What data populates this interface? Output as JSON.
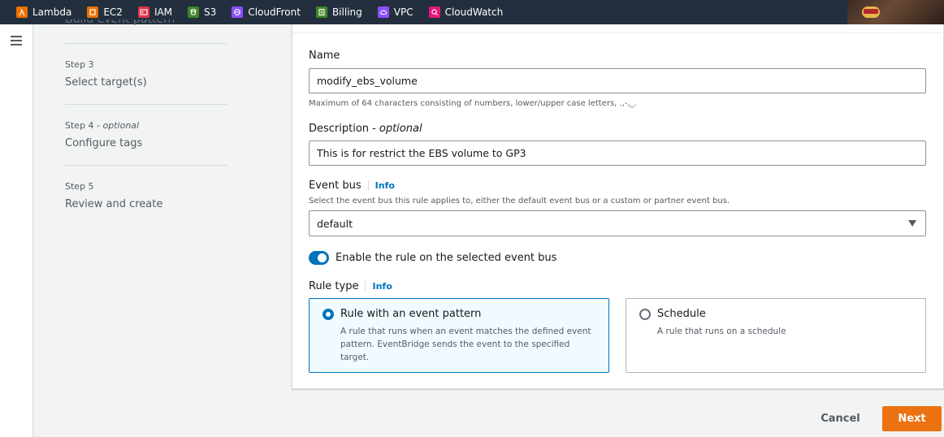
{
  "favorites": [
    {
      "label": "Lambda",
      "icon": "lambda-icon",
      "color": "#ed7100"
    },
    {
      "label": "EC2",
      "icon": "ec2-icon",
      "color": "#ed7100"
    },
    {
      "label": "IAM",
      "icon": "iam-icon",
      "color": "#dd344c"
    },
    {
      "label": "S3",
      "icon": "s3-icon",
      "color": "#3f8624"
    },
    {
      "label": "CloudFront",
      "icon": "cloudfront-icon",
      "color": "#8c4fff"
    },
    {
      "label": "Billing",
      "icon": "billing-icon",
      "color": "#3f8624"
    },
    {
      "label": "VPC",
      "icon": "vpc-icon",
      "color": "#8c4fff"
    },
    {
      "label": "CloudWatch",
      "icon": "cloudwatch-icon",
      "color": "#e7157b"
    }
  ],
  "steps": {
    "cut_off_title": "Build event pattern",
    "items": [
      {
        "number": "Step 3",
        "optional": "",
        "title": "Select target(s)"
      },
      {
        "number": "Step 4",
        "optional": "optional",
        "title": "Configure tags"
      },
      {
        "number": "Step 5",
        "optional": "",
        "title": "Review and create"
      }
    ]
  },
  "form": {
    "name_label": "Name",
    "name_value": "modify_ebs_volume",
    "name_hint": "Maximum of 64 characters consisting of numbers, lower/upper case letters, .,-,_.",
    "description_label": "Description",
    "description_optional": "optional",
    "description_value": "This is for restrict the EBS volume to GP3",
    "event_bus_label": "Event bus",
    "info_label": "Info",
    "event_bus_hint": "Select the event bus this rule applies to, either the default event bus or a custom or partner event bus.",
    "event_bus_value": "default",
    "enable_toggle_label": "Enable the rule on the selected event bus",
    "enable_toggle_on": true,
    "rule_type_label": "Rule type",
    "rule_types": [
      {
        "title": "Rule with an event pattern",
        "description": "A rule that runs when an event matches the defined event pattern. EventBridge sends the event to the specified target.",
        "selected": true
      },
      {
        "title": "Schedule",
        "description": "A rule that runs on a schedule",
        "selected": false
      }
    ]
  },
  "footer": {
    "cancel_label": "Cancel",
    "next_label": "Next"
  },
  "colors": {
    "accent": "#0073bb",
    "primary_button": "#ec7211",
    "topbar": "#232f3e"
  }
}
